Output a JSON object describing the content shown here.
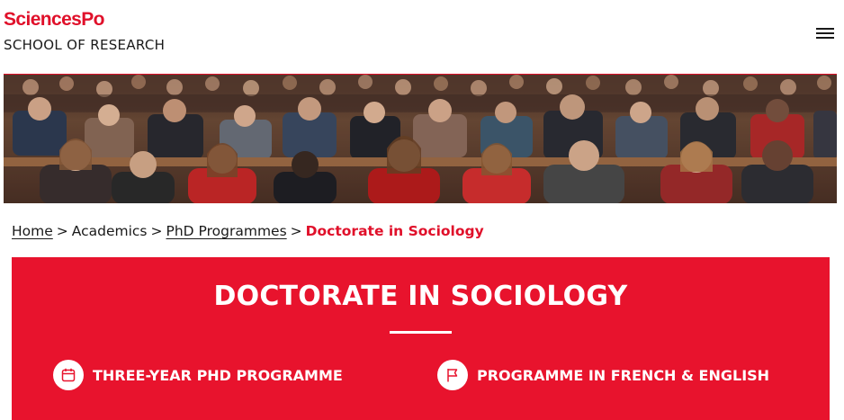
{
  "header": {
    "logo_text": "SciencesPo",
    "subtitle": "SCHOOL OF RESEARCH",
    "menu_icon": "hamburger-menu-icon"
  },
  "hero": {
    "image": "lecture-hall-audience-photo"
  },
  "breadcrumb": {
    "items": [
      {
        "label": "Home",
        "link": true
      },
      {
        "label": "Academics",
        "link": false
      },
      {
        "label": "PhD Programmes",
        "link": true
      }
    ],
    "separator": ">",
    "current": "Doctorate in Sociology"
  },
  "banner": {
    "title": "DOCTORATE IN SOCIOLOGY",
    "features": [
      {
        "icon": "calendar-icon",
        "label": "THREE-YEAR PHD PROGRAMME"
      },
      {
        "icon": "flag-icon",
        "label": "PROGRAMME IN FRENCH & ENGLISH"
      }
    ]
  },
  "colors": {
    "brand_red": "#e0102a",
    "banner_red": "#e8132d",
    "text": "#1a1a1a",
    "white": "#ffffff"
  }
}
